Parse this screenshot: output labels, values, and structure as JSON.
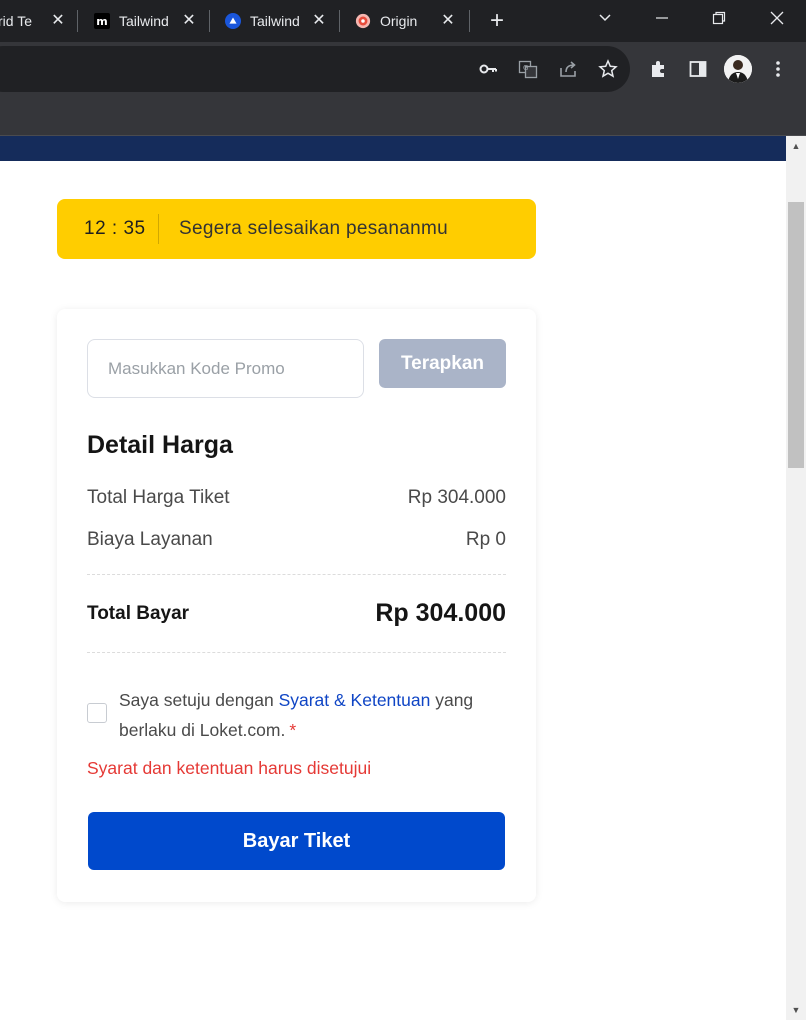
{
  "browser": {
    "tabs": [
      {
        "title": "rid Te",
        "favicon": "generic-page-icon"
      },
      {
        "title": "Tailwind",
        "favicon": "m-logo-icon"
      },
      {
        "title": "Tailwind",
        "favicon": "blue-circle-logo-icon"
      },
      {
        "title": "Origin",
        "favicon": "sticker-icon"
      }
    ],
    "close_glyph": "✕",
    "new_tab_glyph": "+",
    "toolbar_icons": [
      "key-icon",
      "translate-icon",
      "share-icon",
      "star-icon",
      "extensions-icon",
      "sidepanel-icon",
      "profile-avatar",
      "menu-icon"
    ]
  },
  "timer": {
    "time": "12 : 35",
    "message": "Segera selesaikan pesananmu",
    "color": "#ffcd00"
  },
  "promo": {
    "placeholder": "Masukkan Kode Promo",
    "value": "",
    "button_label": "Terapkan"
  },
  "price_detail": {
    "title": "Detail Harga",
    "rows": [
      {
        "label": "Total Harga Tiket",
        "value": "Rp 304.000"
      },
      {
        "label": "Biaya Layanan",
        "value": "Rp 0"
      }
    ],
    "total_label": "Total Bayar",
    "total_value": "Rp 304.000"
  },
  "agreement": {
    "prefix": "Saya setuju dengan ",
    "link_text": "Syarat & Ketentuan",
    "suffix": " yang berlaku di Loket.com.",
    "required_mark": "*",
    "checked": false,
    "error": "Syarat dan ketentuan harus disetujui"
  },
  "pay_button": {
    "label": "Bayar Tiket",
    "color": "#0049cc"
  }
}
